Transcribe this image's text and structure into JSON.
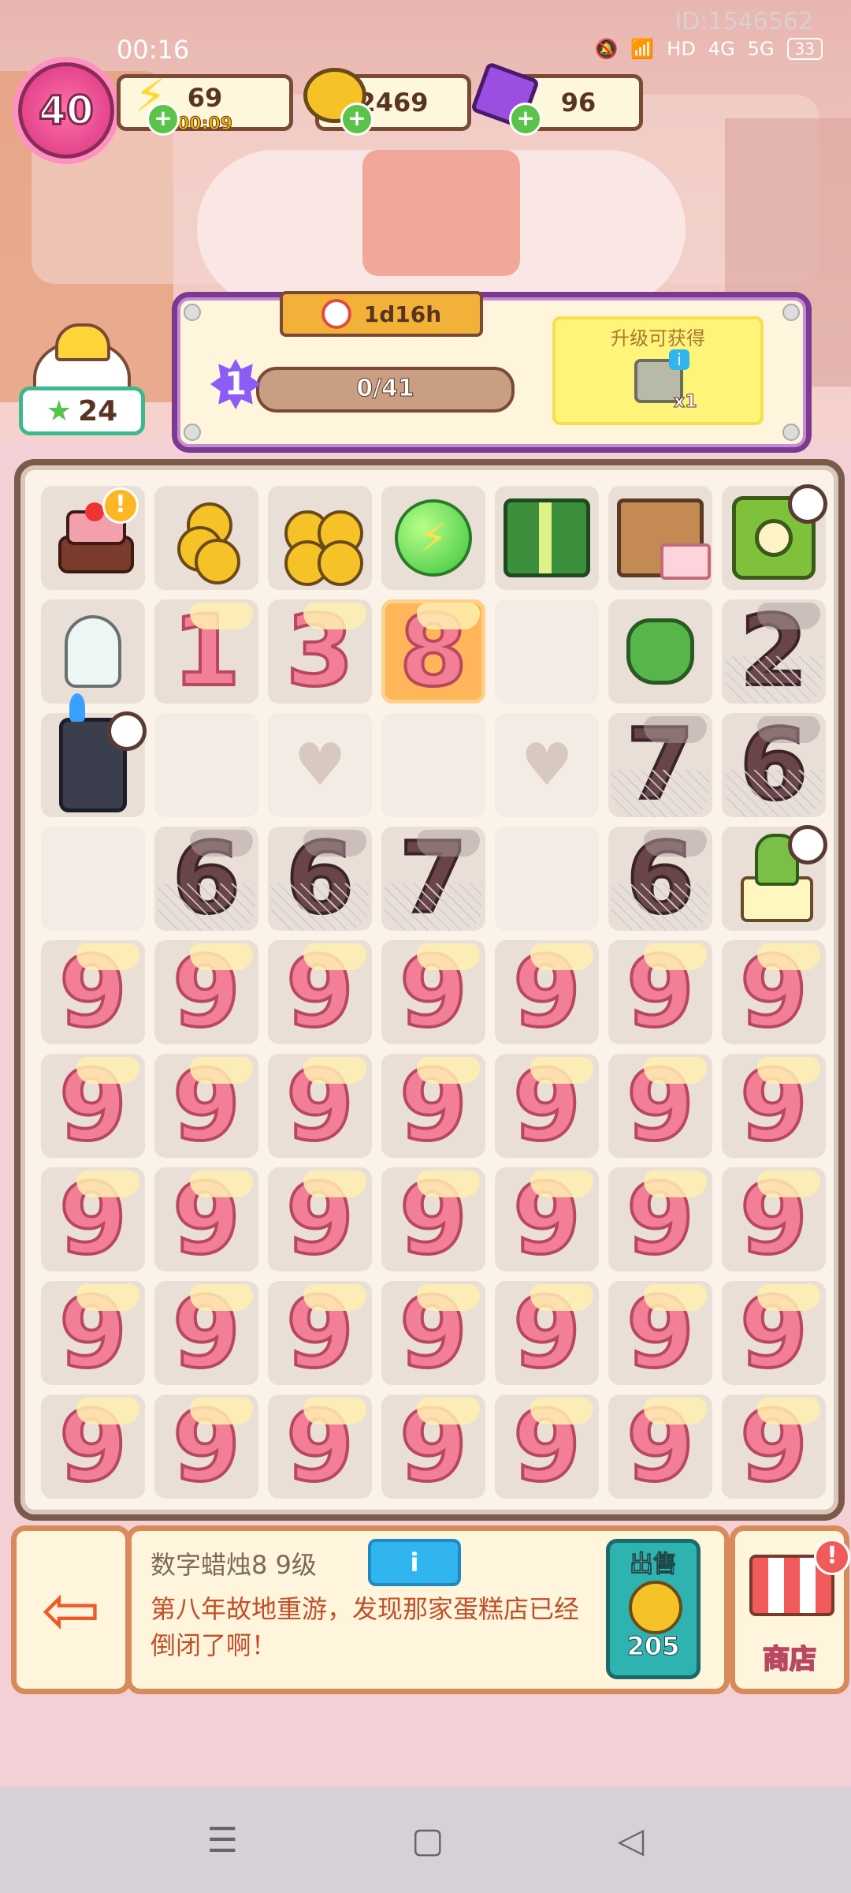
{
  "status_bar": {
    "time": "00:16",
    "id_label": "ID:1546562",
    "network": "4G",
    "network2": "5G",
    "hd": "HD",
    "battery": "33"
  },
  "hud": {
    "level": "40",
    "energy": {
      "value": "69",
      "timer": "00:09"
    },
    "coins": "2469",
    "gems": "96",
    "helper_count": "24"
  },
  "event": {
    "timer": "1d16h",
    "level": "1",
    "progress": "0/41",
    "progress_fraction": 0.0,
    "reward_title": "升级可获得",
    "reward_qty": "x1",
    "reward_info": "i"
  },
  "board": {
    "rows": [
      [
        {
          "type": "cake",
          "alert": "!"
        },
        {
          "type": "coins-small"
        },
        {
          "type": "coins-big"
        },
        {
          "type": "energy-orb",
          "glyph": "⚡"
        },
        {
          "type": "gift"
        },
        {
          "type": "box"
        },
        {
          "type": "clock-machine",
          "timer": true
        }
      ],
      [
        {
          "type": "bulb"
        },
        {
          "type": "candle",
          "digit": "1"
        },
        {
          "type": "candle",
          "digit": "3"
        },
        {
          "type": "candle",
          "digit": "8",
          "selected": true
        },
        {
          "type": "empty"
        },
        {
          "type": "pouch"
        },
        {
          "type": "candle-dark",
          "digit": "2",
          "web": true
        }
      ],
      [
        {
          "type": "lighter",
          "timer": true
        },
        {
          "type": "empty"
        },
        {
          "type": "heart"
        },
        {
          "type": "empty"
        },
        {
          "type": "heart"
        },
        {
          "type": "candle-dark",
          "digit": "7",
          "web": true
        },
        {
          "type": "candle-dark",
          "digit": "6",
          "web": true
        }
      ],
      [
        {
          "type": "empty"
        },
        {
          "type": "candle-dark",
          "digit": "6",
          "web": true
        },
        {
          "type": "candle-dark",
          "digit": "6",
          "web": true
        },
        {
          "type": "candle-dark",
          "digit": "7",
          "web": true
        },
        {
          "type": "empty"
        },
        {
          "type": "candle-dark",
          "digit": "6",
          "web": true
        },
        {
          "type": "cactus",
          "timer": true
        }
      ],
      [
        {
          "type": "candle",
          "digit": "9"
        },
        {
          "type": "candle",
          "digit": "9"
        },
        {
          "type": "candle",
          "digit": "9"
        },
        {
          "type": "candle",
          "digit": "9"
        },
        {
          "type": "candle",
          "digit": "9"
        },
        {
          "type": "candle",
          "digit": "9"
        },
        {
          "type": "candle",
          "digit": "9"
        }
      ],
      [
        {
          "type": "candle",
          "digit": "9"
        },
        {
          "type": "candle",
          "digit": "9"
        },
        {
          "type": "candle",
          "digit": "9"
        },
        {
          "type": "candle",
          "digit": "9"
        },
        {
          "type": "candle",
          "digit": "9"
        },
        {
          "type": "candle",
          "digit": "9"
        },
        {
          "type": "candle",
          "digit": "9"
        }
      ],
      [
        {
          "type": "candle",
          "digit": "9"
        },
        {
          "type": "candle",
          "digit": "9"
        },
        {
          "type": "candle",
          "digit": "9"
        },
        {
          "type": "candle",
          "digit": "9"
        },
        {
          "type": "candle",
          "digit": "9"
        },
        {
          "type": "candle",
          "digit": "9"
        },
        {
          "type": "candle",
          "digit": "9"
        }
      ],
      [
        {
          "type": "candle",
          "digit": "9"
        },
        {
          "type": "candle",
          "digit": "9"
        },
        {
          "type": "candle",
          "digit": "9"
        },
        {
          "type": "candle",
          "digit": "9"
        },
        {
          "type": "candle",
          "digit": "9"
        },
        {
          "type": "candle",
          "digit": "9"
        },
        {
          "type": "candle",
          "digit": "9"
        }
      ],
      [
        {
          "type": "candle",
          "digit": "9"
        },
        {
          "type": "candle",
          "digit": "9"
        },
        {
          "type": "candle",
          "digit": "9"
        },
        {
          "type": "candle",
          "digit": "9"
        },
        {
          "type": "candle",
          "digit": "9"
        },
        {
          "type": "candle",
          "digit": "9"
        },
        {
          "type": "candle",
          "digit": "9"
        }
      ]
    ]
  },
  "info": {
    "title": "数字蜡烛8 9级",
    "info_button": "i",
    "description": "第八年故地重游，发现那家蛋糕店已经倒闭了啊！",
    "sell_label": "出售",
    "sell_value": "205"
  },
  "shop": {
    "label": "商店",
    "alert": "!"
  },
  "navbar": {
    "menu": "☰",
    "home": "▢",
    "back": "◁"
  }
}
